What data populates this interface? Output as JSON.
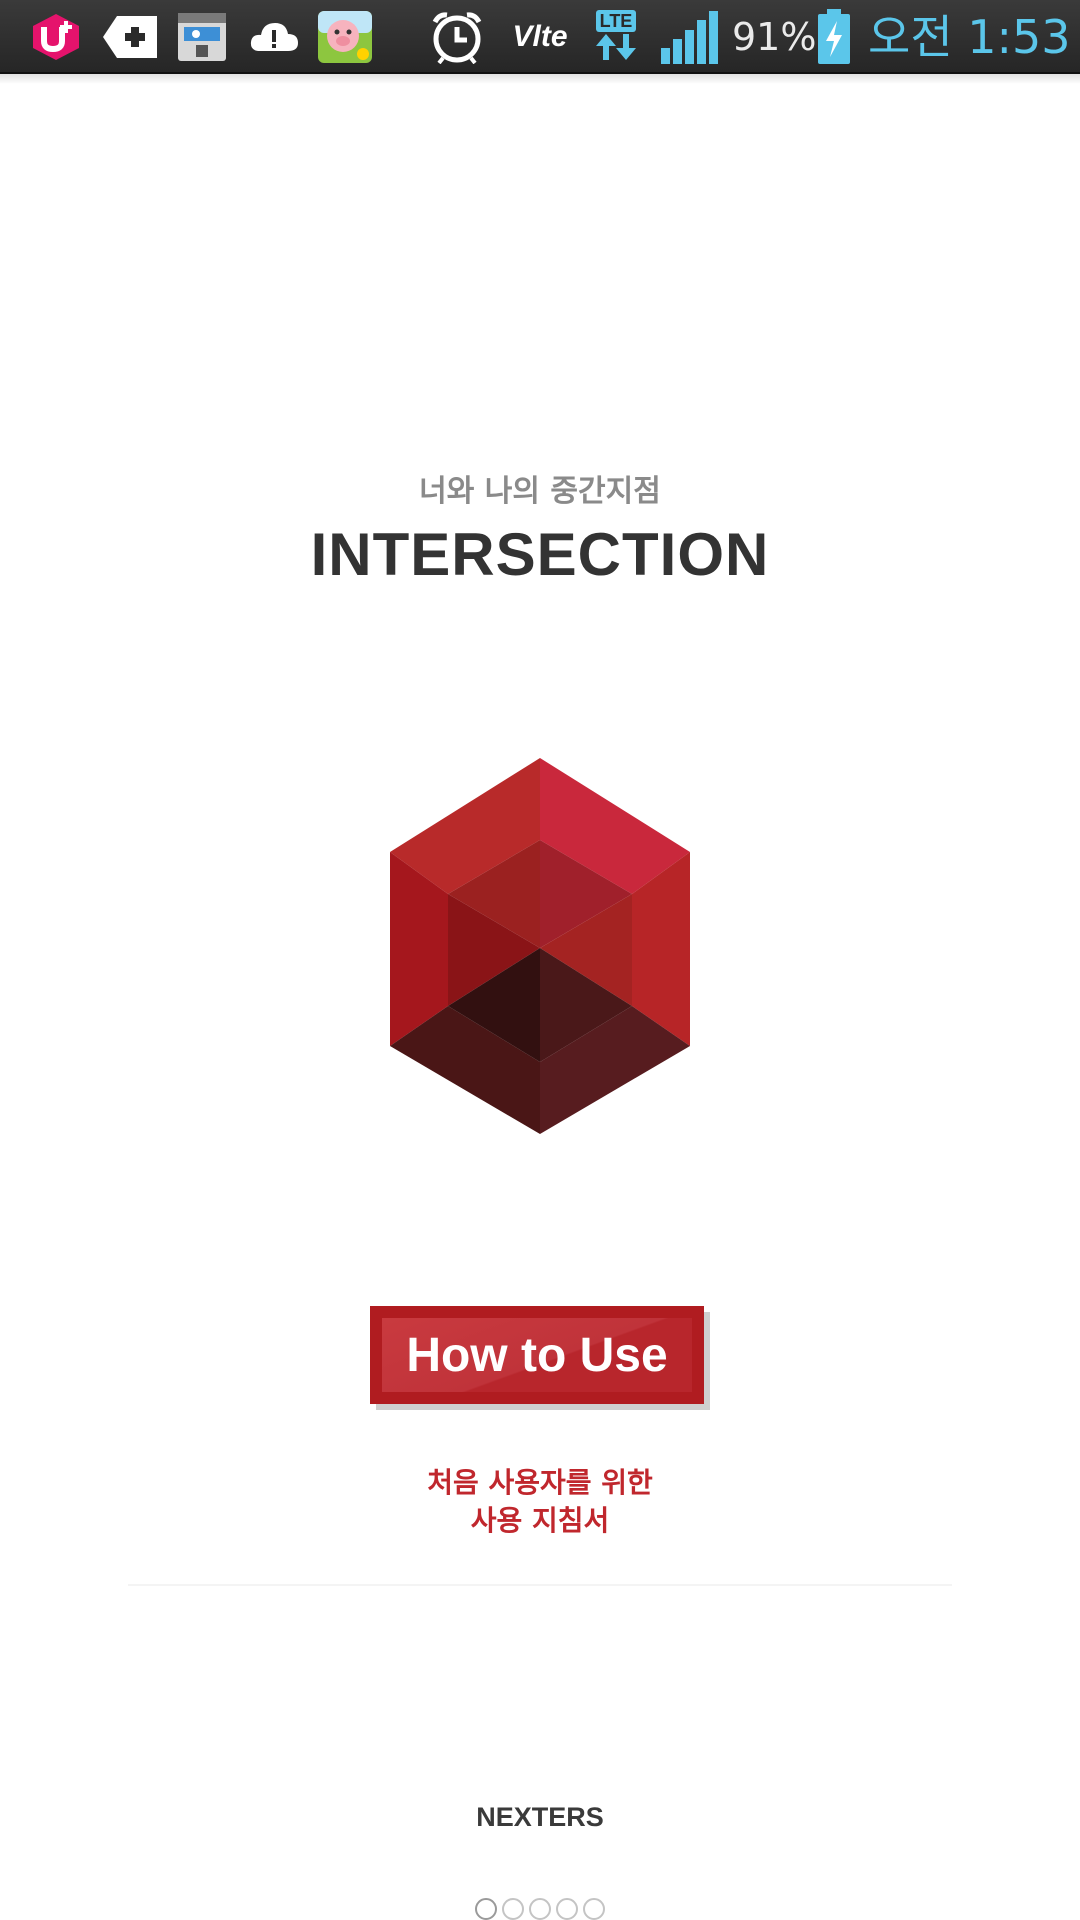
{
  "status_bar": {
    "icons": [
      "lg-uplus-icon",
      "medical-cross-tag-icon",
      "device-cleaner-icon",
      "cloud-alert-icon",
      "pig-game-app-icon",
      "alarm-clock-icon",
      "volte-icon",
      "lte-data-icon",
      "signal-strength-icon",
      "battery-charging-icon"
    ],
    "volte_label": "Vlte",
    "lte_label": "LTE",
    "battery_percent": "91%",
    "time": "오전 1:53",
    "colors": {
      "clock": "#5bc6ea",
      "signal": "#5bc6ea",
      "uplus": "#e5136c"
    }
  },
  "main": {
    "subtitle": "너와 나의 중간지점",
    "title": "INTERSECTION",
    "logo_icon": "red-hexagon-cube-logo",
    "how_to_use_label": "How to Use",
    "guide_lines": [
      "처음 사용자를 위한",
      "사용 지침서"
    ],
    "brand": "NEXTERS",
    "page_indicator": {
      "total": 5,
      "current": 1
    },
    "colors": {
      "accent": "#b01c20",
      "guide_text": "#c0272d",
      "title": "#333333"
    }
  }
}
